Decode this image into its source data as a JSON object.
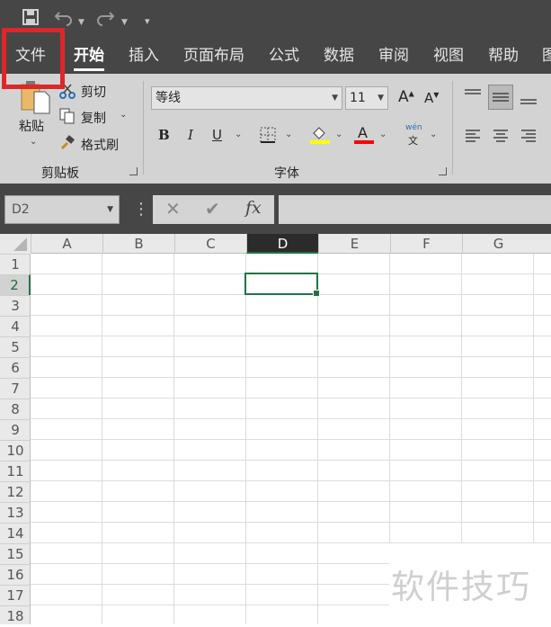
{
  "qat": {
    "save_icon": "save-icon",
    "undo_icon": "undo-icon",
    "redo_icon": "redo-icon",
    "customize_icon": "customize-qat-icon"
  },
  "tabs": [
    {
      "label": "文件"
    },
    {
      "label": "开始"
    },
    {
      "label": "插入"
    },
    {
      "label": "页面布局"
    },
    {
      "label": "公式"
    },
    {
      "label": "数据"
    },
    {
      "label": "审阅"
    },
    {
      "label": "视图"
    },
    {
      "label": "帮助"
    },
    {
      "label": "图"
    }
  ],
  "active_tab": "开始",
  "highlight_color": "#e02626",
  "clipboard": {
    "paste_label": "粘贴",
    "cut_label": "剪切",
    "copy_label": "复制",
    "format_painter_label": "格式刷",
    "group_label": "剪贴板"
  },
  "font": {
    "font_name": "等线",
    "font_size": "11",
    "bold": "B",
    "italic": "I",
    "underline": "U",
    "increase_icon": "A",
    "decrease_icon": "A",
    "wen_top": "wén",
    "wen_bottom": "文",
    "font_color_letter": "A",
    "highlight_color": "#ffff00",
    "font_color": "#ff0000",
    "group_label": "字体"
  },
  "namebox": {
    "value": "D2"
  },
  "formula_bar": {
    "cancel": "✕",
    "enter": "✔",
    "fx": "fx",
    "value": ""
  },
  "columns": [
    "A",
    "B",
    "C",
    "D",
    "E",
    "F",
    "G"
  ],
  "rows": [
    "1",
    "2",
    "3",
    "4",
    "5",
    "6",
    "7",
    "8",
    "9",
    "10",
    "11",
    "12",
    "13",
    "14",
    "15",
    "16",
    "17",
    "18"
  ],
  "selected_cell": "D2",
  "accent_color": "#217346",
  "watermark": "软件技巧"
}
